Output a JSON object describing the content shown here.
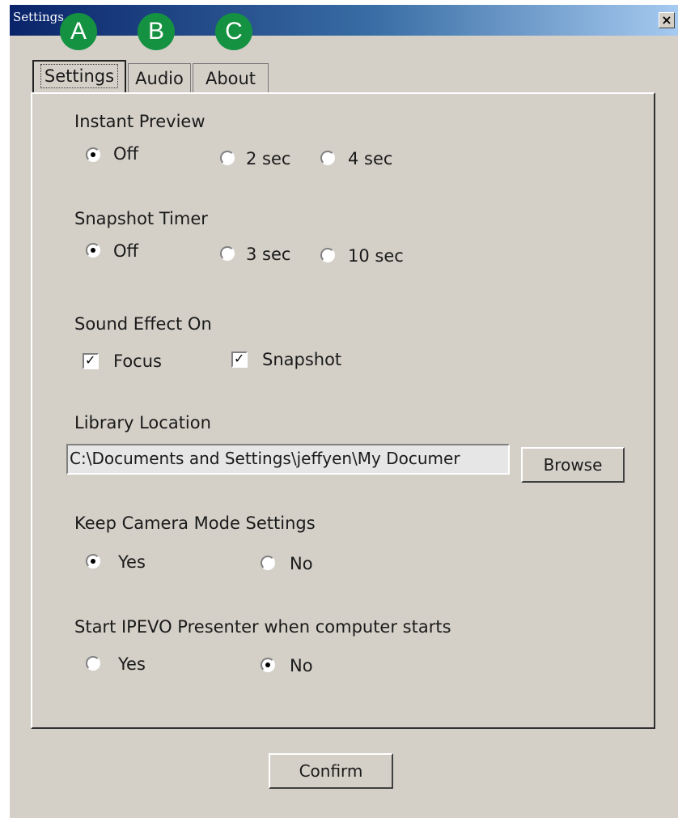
{
  "window": {
    "title": "Settings",
    "close_glyph": "×"
  },
  "callouts": [
    "A",
    "B",
    "C"
  ],
  "tabs": [
    {
      "label": "Settings",
      "active": true
    },
    {
      "label": "Audio",
      "active": false
    },
    {
      "label": "About",
      "active": false
    }
  ],
  "instant_preview": {
    "heading": "Instant Preview",
    "options": [
      {
        "label": "Off",
        "checked": true
      },
      {
        "label": "2 sec",
        "checked": false
      },
      {
        "label": "4 sec",
        "checked": false
      }
    ]
  },
  "snapshot_timer": {
    "heading": "Snapshot Timer",
    "options": [
      {
        "label": "Off",
        "checked": true
      },
      {
        "label": "3 sec",
        "checked": false
      },
      {
        "label": "10 sec",
        "checked": false
      }
    ]
  },
  "sound_effect": {
    "heading": "Sound Effect On",
    "options": [
      {
        "label": "Focus",
        "checked": true
      },
      {
        "label": "Snapshot",
        "checked": true
      }
    ]
  },
  "library": {
    "heading": "Library Location",
    "path": "C:\\Documents and Settings\\jeffyen\\My Documer",
    "browse_label": "Browse"
  },
  "keep_camera": {
    "heading": "Keep Camera Mode Settings",
    "options": [
      {
        "label": "Yes",
        "checked": true
      },
      {
        "label": "No",
        "checked": false
      }
    ]
  },
  "start_presenter": {
    "heading": "Start IPEVO Presenter when computer starts",
    "options": [
      {
        "label": "Yes",
        "checked": false
      },
      {
        "label": "No",
        "checked": true
      }
    ]
  },
  "confirm_label": "Confirm",
  "colors": {
    "titlebar": "#0a246a",
    "badge": "#159142",
    "face": "#d4d0c8"
  }
}
